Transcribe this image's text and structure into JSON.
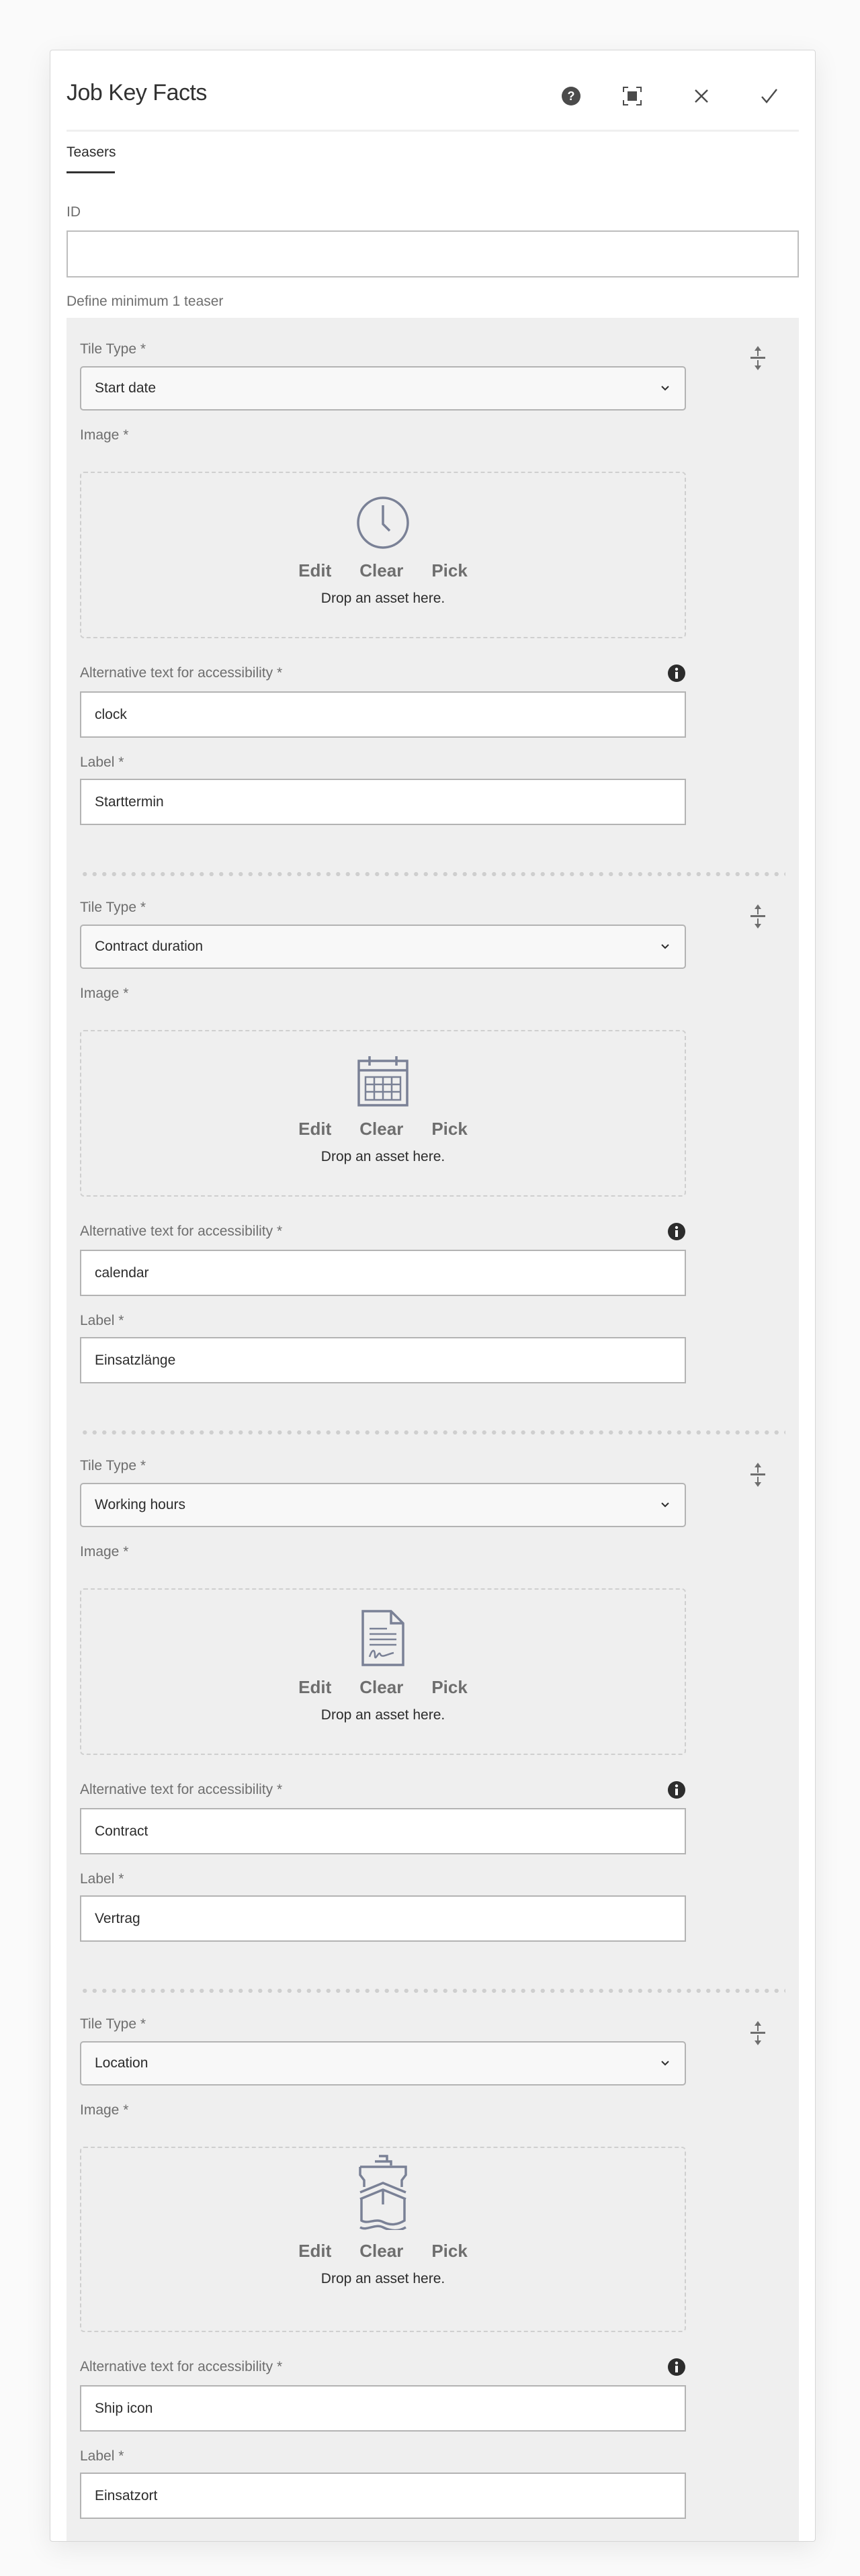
{
  "dialog": {
    "title": "Job Key Facts",
    "icons": [
      "help-icon",
      "fullscreen-icon",
      "close-icon",
      "check-icon"
    ],
    "tab": "Teasers",
    "id_label": "ID",
    "id_value": "",
    "define_label": "Define minimum 1 teaser"
  },
  "teasers": [
    {
      "tile_type_label": "Tile Type *",
      "tile_type": "Start date",
      "image_label": "Image *",
      "icon": "clock-icon",
      "edit": "Edit",
      "clear": "Clear",
      "pick": "Pick",
      "drop_text": "Drop an asset here.",
      "alt_label": "Alternative text for accessibility *",
      "alt_value": "clock",
      "label_label": "Label *",
      "label_value": "Starttermin"
    },
    {
      "tile_type_label": "Tile Type *",
      "tile_type": "Contract duration",
      "image_label": "Image *",
      "icon": "calendar-icon",
      "edit": "Edit",
      "clear": "Clear",
      "pick": "Pick",
      "drop_text": "Drop an asset here.",
      "alt_label": "Alternative text for accessibility *",
      "alt_value": "calendar",
      "label_label": "Label *",
      "label_value": "Einsatzlänge"
    },
    {
      "tile_type_label": "Tile Type *",
      "tile_type": "Working hours",
      "image_label": "Image *",
      "icon": "contract-document-icon",
      "edit": "Edit",
      "clear": "Clear",
      "pick": "Pick",
      "drop_text": "Drop an asset here.",
      "alt_label": "Alternative text for accessibility *",
      "alt_value": "Contract",
      "label_label": "Label *",
      "label_value": "Vertrag"
    },
    {
      "tile_type_label": "Tile Type *",
      "tile_type": "Location",
      "image_label": "Image *",
      "icon": "ship-icon",
      "edit": "Edit",
      "clear": "Clear",
      "pick": "Pick",
      "drop_text": "Drop an asset here.",
      "alt_label": "Alternative text for accessibility *",
      "alt_value": "Ship icon",
      "label_label": "Label *",
      "label_value": "Einsatzort"
    }
  ],
  "colors": {
    "asset_icon": "#7a8196",
    "panel": "#efefef"
  }
}
